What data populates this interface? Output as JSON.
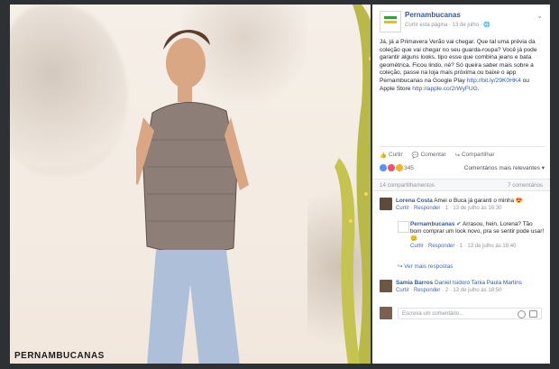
{
  "brand_watermark": "PERNAMBUCANAS",
  "post": {
    "page_name": "Pernambucanas",
    "meta": "Curtir esta página · 13 de julho · 🌐",
    "text": "Já, já a Primavera Verão vai chegar. Que tal uma prévia da coleção que vai chegar no seu guarda-roupa? Você já pode garantir alguns looks, tipo esse que combina jeans e bata geométrica. Ficou lindo, né? Só queira saber mais sobre a coleção, passe na loja mais próxima ou baixe o app Pernambucanas na Google Play ",
    "link1": "http://bit.ly/29K0HK4",
    "text2": " ou Apple Store ",
    "link2": "http://apple.co/2rWyFUG",
    "text3": "."
  },
  "actions": {
    "like": "Curtir",
    "comment": "Comentar",
    "share": "Compartilhar"
  },
  "reactions": {
    "count": "345",
    "sort": "Comentários mais relevantes ▾"
  },
  "comments_header": {
    "left": "14 compartilhamentos",
    "right": "7 comentários"
  },
  "comments": [
    {
      "author": "Lorena Costa",
      "text": "Amei o Buca já garanti o minha 😍",
      "meta_like": "Curtir",
      "meta_reply": "Responder",
      "meta_count": "1",
      "meta_time": "13 de julho às 16:30"
    },
    {
      "author": "Pernambucanas",
      "text": "Arrasou, hein, Lorena? Tão bom comprar um look novo, pra se sentir pode usar! 😊",
      "meta_like": "Curtir",
      "meta_reply": "Responder",
      "meta_count": "1",
      "meta_time": "13 de julho às 18:40"
    },
    {
      "more": "↪ Ver mais respostas"
    },
    {
      "author": "Samia Barros",
      "text": "Daniel Isidoro Tania Paula Martins",
      "meta_like": "Curtir",
      "meta_reply": "Responder",
      "meta_count": "2",
      "meta_time": "13 de julho às 18:50"
    }
  ],
  "comment_input": {
    "placeholder": "Escreva um comentário..."
  },
  "colors": {
    "link": "#365899",
    "bg_panel": "#ffffff",
    "accent": "#4267b2"
  }
}
